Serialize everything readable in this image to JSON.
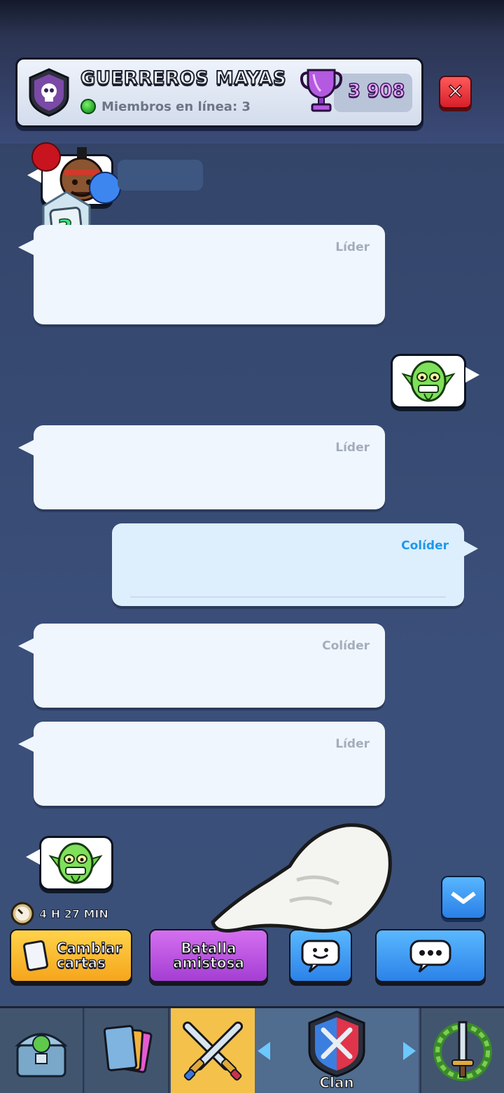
{
  "header": {
    "clan_name": "GUERREROS MAYAS",
    "online_members": "Miembros en línea: 3",
    "trophies": "3 908",
    "close_icon": "close-icon"
  },
  "chat": {
    "level_badge": "3",
    "messages": [
      {
        "role": "Líder"
      },
      {
        "role": "Líder"
      },
      {
        "role": "Colíder"
      },
      {
        "role": "Colíder"
      },
      {
        "role": "Líder"
      }
    ],
    "timer": "4 H 27 MIN"
  },
  "actions": {
    "change_cards_line1": "Cambiar",
    "change_cards_line2": "cartas",
    "friendly_battle_line1": "Batalla",
    "friendly_battle_line2": "amistosa"
  },
  "nav": {
    "clan_label": "Clan",
    "items": [
      "shop-icon",
      "cards-icon",
      "battle-icon",
      "clan-icon",
      "events-icon"
    ]
  },
  "colors": {
    "accent_blue": "#2b82e8",
    "gold": "#f5a51c",
    "purple": "#a43ed3",
    "close_red": "#d81e2a",
    "trophy_text": "#e7a6ff"
  }
}
